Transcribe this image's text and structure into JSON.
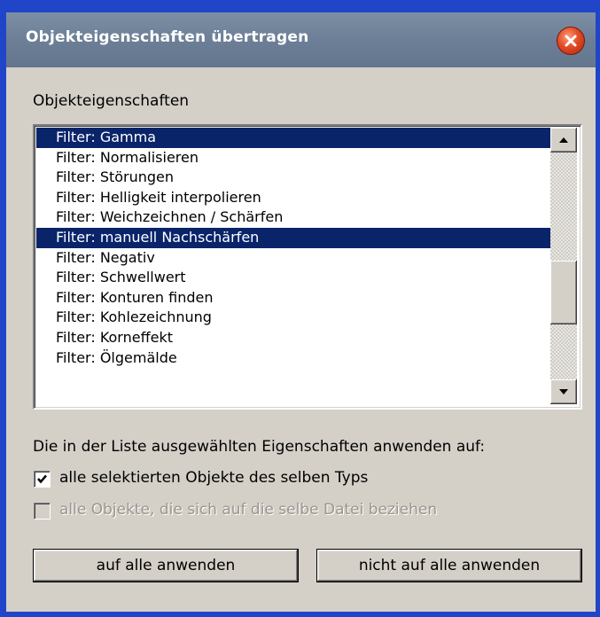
{
  "window": {
    "title": "Objekteigenschaften übertragen"
  },
  "list": {
    "label": "Objekteigenschaften",
    "items": [
      {
        "label": "Filter: Gamma",
        "selected": true
      },
      {
        "label": "Filter: Normalisieren",
        "selected": false
      },
      {
        "label": "Filter: Störungen",
        "selected": false
      },
      {
        "label": "Filter: Helligkeit interpolieren",
        "selected": false
      },
      {
        "label": "Filter: Weichzeichnen / Schärfen",
        "selected": false
      },
      {
        "label": "Filter: manuell Nachschärfen",
        "selected": true
      },
      {
        "label": "Filter: Negativ",
        "selected": false
      },
      {
        "label": "Filter: Schwellwert",
        "selected": false
      },
      {
        "label": "Filter: Konturen finden",
        "selected": false
      },
      {
        "label": "Filter: Kohlezeichnung",
        "selected": false
      },
      {
        "label": "Filter: Korneffekt",
        "selected": false
      },
      {
        "label": "Filter: Ölgemälde",
        "selected": false
      }
    ]
  },
  "apply": {
    "heading": "Die in der Liste ausgewählten Eigenschaften anwenden auf:",
    "option_same_type": {
      "label": "alle selektierten Objekte des selben Typs",
      "checked": true,
      "enabled": true
    },
    "option_same_file": {
      "label": "alle Objekte, die sich auf die selbe Datei beziehen",
      "checked": false,
      "enabled": false
    }
  },
  "buttons": {
    "apply_all": "auf alle anwenden",
    "not_apply_all": "nicht auf alle anwenden"
  },
  "icons": {
    "close": "close-icon",
    "scroll_up": "arrow-up-icon",
    "scroll_down": "arrow-down-icon",
    "check": "checkmark-icon"
  },
  "colors": {
    "selection": "#0a246a",
    "titlebar": "#6c7f96",
    "close_button": "#e14b26",
    "dialog_bg": "#d4d0c8"
  }
}
